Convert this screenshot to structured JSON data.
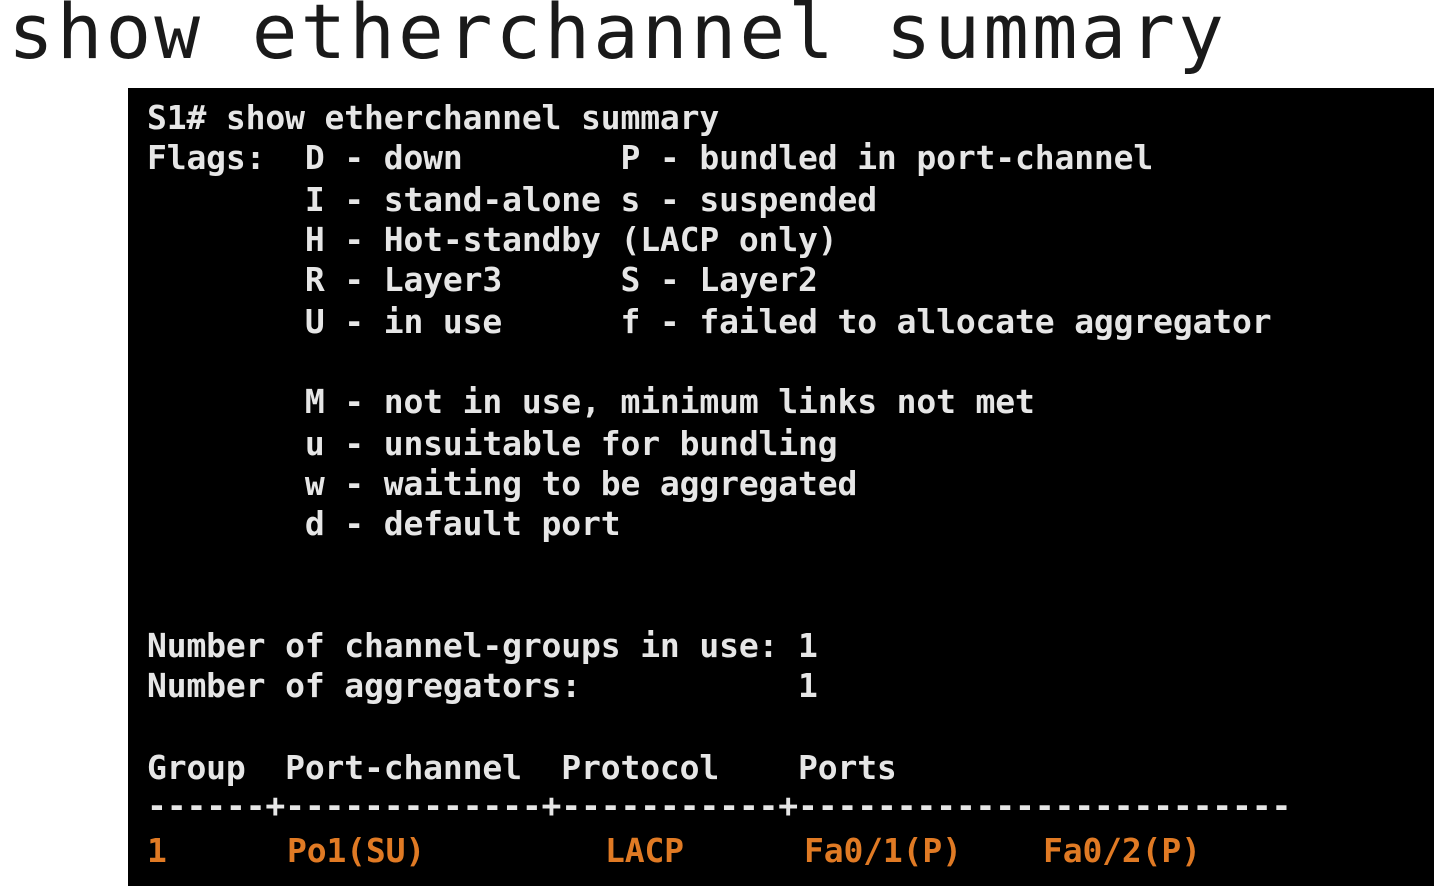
{
  "slide": {
    "title": "show etherchannel summary"
  },
  "terminal": {
    "colors": {
      "background": "#000000",
      "text": "#e6e6e6",
      "highlight": "#e07a24"
    },
    "prompt_line": "S1# show etherchannel summary",
    "flag_lines": [
      "Flags:  D - down        P - bundled in port-channel",
      "        I - stand-alone s - suspended",
      "        H - Hot-standby (LACP only)",
      "        R - Layer3      S - Layer2",
      "        U - in use      f - failed to allocate aggregator",
      "        M - not in use, minimum links not met",
      "        u - unsuitable for bundling",
      "        w - waiting to be aggregated",
      "        d - default port"
    ],
    "summary_lines": [
      "Number of channel-groups in use: 1",
      "Number of aggregators:           1"
    ],
    "table": {
      "header": "Group  Port-channel  Protocol    Ports",
      "separator": "------+-------------+-----------+-------------------------",
      "row": {
        "group": "1",
        "port_channel": "Po1(SU)",
        "protocol": "LACP",
        "port_1": "Fa0/1(P)",
        "port_2": "Fa0/2(P)"
      }
    }
  }
}
